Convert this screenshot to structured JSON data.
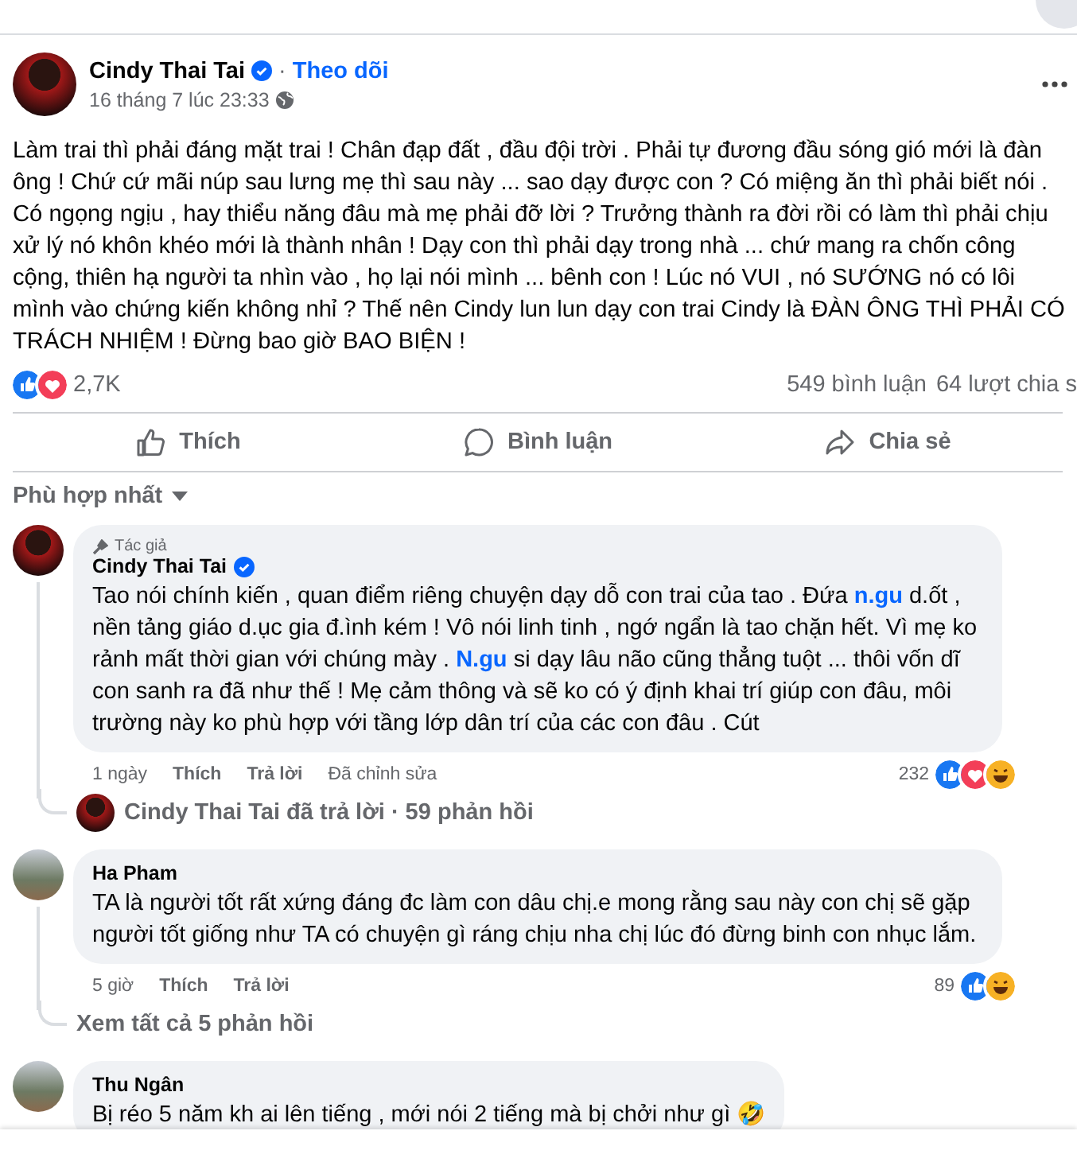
{
  "post": {
    "author": "Cindy Thai Tai",
    "verified": true,
    "separator": "·",
    "follow": "Theo dõi",
    "time": "16 tháng 7 lúc 23:33",
    "text": "Làm trai thì phải đáng mặt trai ! Chân đạp đất , đầu đội trời . Phải tự đương đầu sóng gió mới là đàn ông ! Chứ cứ mãi núp sau lưng mẹ thì sau này ... sao dạy được con ? Có miệng ăn thì phải biết nói . Có ngọng ngịu , hay thiểu năng đâu mà mẹ phải đỡ lời ? Trưởng thành ra đời rồi có làm thì phải chịu xử lý nó khôn khéo mới là thành nhân ! Dạy con thì phải dạy trong nhà ... chứ mang ra chốn công cộng, thiên hạ người ta nhìn vào , họ lại nói mình ... bênh con ! Lúc nó VUI , nó SƯỚNG nó có lôi mình vào chứng kiến không nhỉ ? Thế nên Cindy lun lun dạy con trai Cindy là ĐÀN ÔNG THÌ PHẢI CÓ TRÁCH NHIỆM ! Đừng bao giờ BAO BIỆN !",
    "reactions": [
      {
        "kind": "like"
      },
      {
        "kind": "love"
      }
    ],
    "reaction_count": "2,7K",
    "comments": "549 bình luận",
    "shares": "64 lượt chia s"
  },
  "actions": [
    {
      "kind": "like",
      "label": "Thích"
    },
    {
      "kind": "comment",
      "label": "Bình luận"
    },
    {
      "kind": "share",
      "label": "Chia sẻ"
    }
  ],
  "sort": "Phù hợp nhất",
  "comments": [
    {
      "author_badge": "Tác giả",
      "author": "Cindy Thai Tai",
      "verified": true,
      "segments": [
        {
          "kind": "plain",
          "text": "Tao nói chính kiến , quan điểm riêng chuyện dạy dỗ con trai của tao . Đứa "
        },
        {
          "kind": "link",
          "text": "n.gu"
        },
        {
          "kind": "plain",
          "text": " d.ốt , nền tảng giáo d.ục gia đ.ình kém ! Vô nói linh tinh , ngớ ngẩn là tao chặn hết. Vì mẹ ko rảnh mất thời gian với chúng mày . "
        },
        {
          "kind": "link",
          "text": "N.gu"
        },
        {
          "kind": "plain",
          "text": " si dạy lâu não cũng thẳng tuột ... thôi vốn dĩ con sanh ra đã như thế ! Mẹ cảm thông và sẽ ko có ý định khai trí giúp con đâu, môi trường này ko phù hợp với tầng lớp dân trí của các con đâu . Cút"
        }
      ],
      "meta": [
        "1 ngày",
        "Thích",
        "Trả lời",
        "Đã chỉnh sửa"
      ],
      "count": "232",
      "reactions": [
        {
          "kind": "like"
        },
        {
          "kind": "love"
        },
        {
          "kind": "haha"
        }
      ],
      "replies": "Cindy Thai Tai đã trả lời · 59 phản hồi",
      "replies_avatar": true
    },
    {
      "author": "Ha Pham",
      "verified": false,
      "segments": [
        {
          "kind": "plain",
          "text": "TA là người tốt rất xứng đáng đc làm con dâu chị.e mong rằng sau này con chị sẽ gặp người tốt giống như TA có chuyện gì ráng chịu nha chị lúc đó đừng binh con nhục lắm."
        }
      ],
      "meta": [
        "5 giờ",
        "Thích",
        "Trả lời"
      ],
      "count": "89",
      "reactions": [
        {
          "kind": "like"
        },
        {
          "kind": "haha"
        }
      ],
      "replies": "Xem tất cả 5 phản hồi",
      "replies_avatar": false
    },
    {
      "author": "Thu Ngân",
      "verified": false,
      "segments": [
        {
          "kind": "plain",
          "text": "Bị réo 5 năm kh ai lên tiếng , mới nói 2 tiếng mà bị chởi như gì 🤣"
        }
      ]
    }
  ]
}
